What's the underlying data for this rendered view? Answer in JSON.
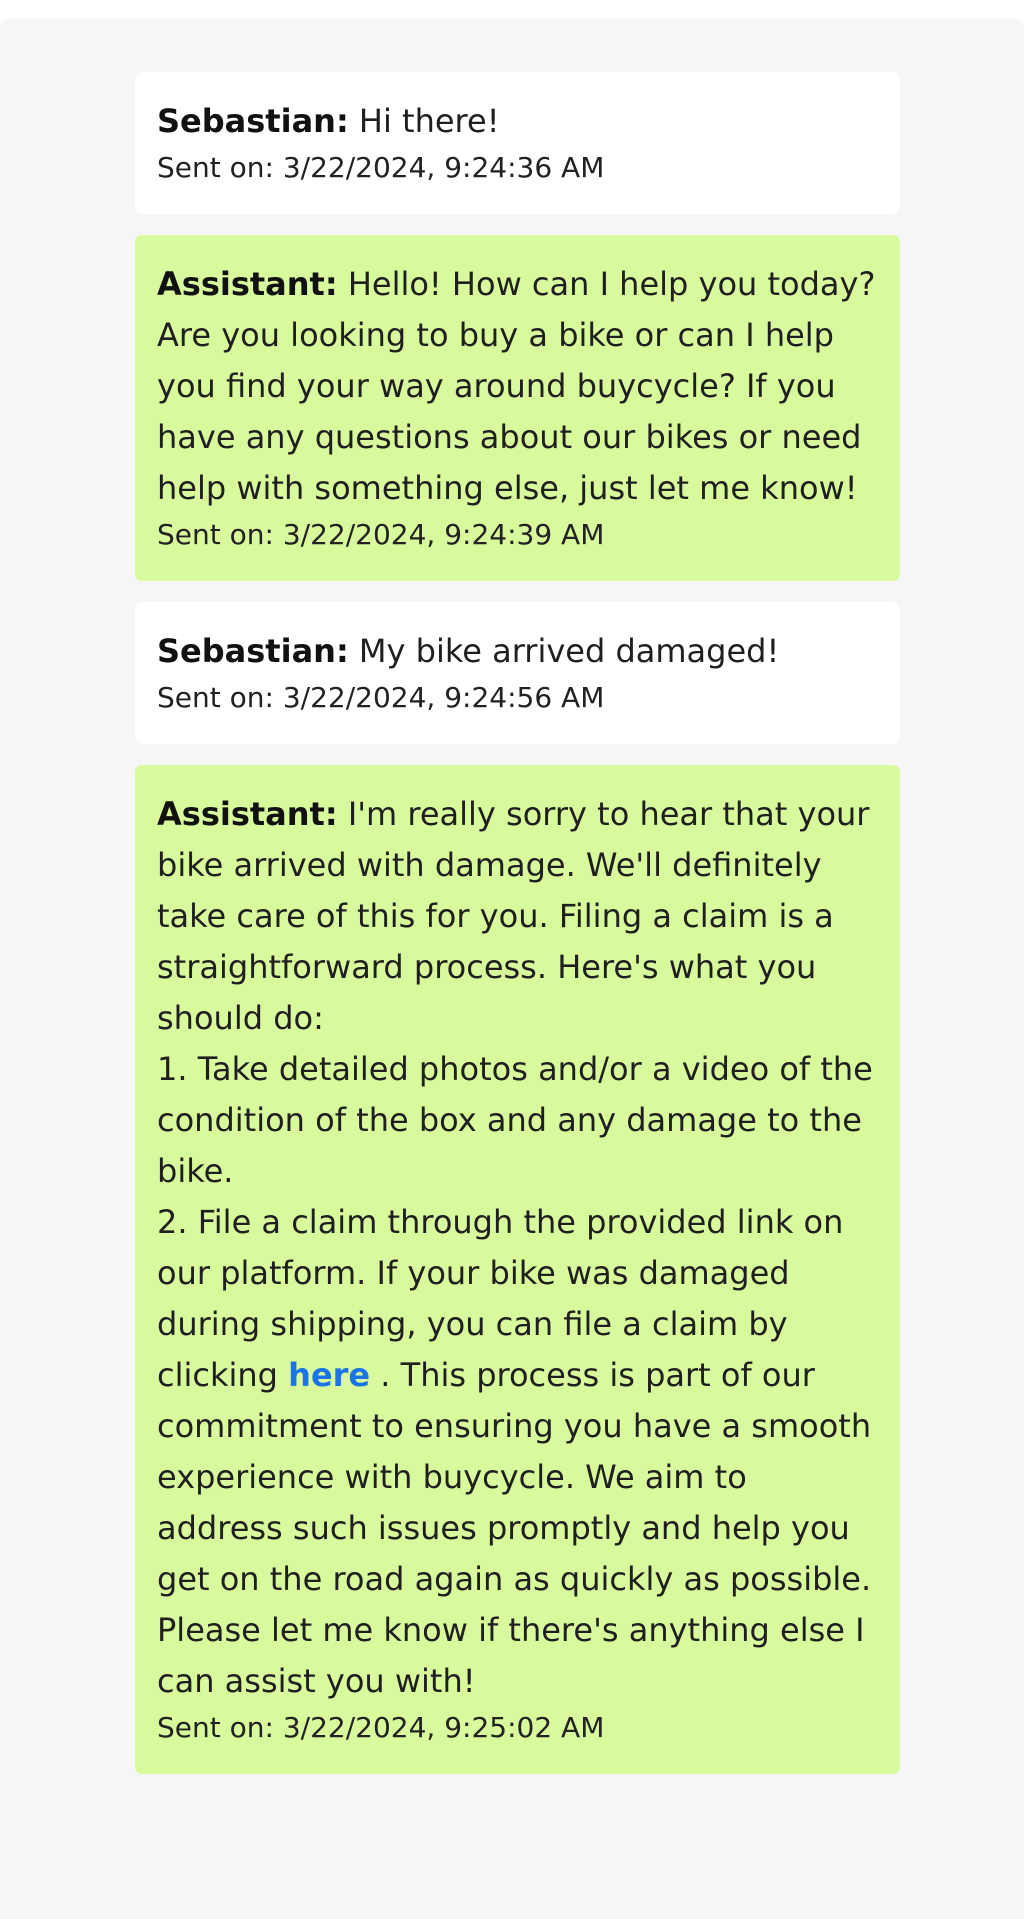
{
  "messages": [
    {
      "sender": "Sebastian:",
      "text": "Hi there!",
      "timestamp": "Sent on: 3/22/2024, 9:24:36 AM"
    },
    {
      "sender": "Assistant:",
      "text": "Hello! How can I help you today? Are you looking to buy a bike or can I help you find your way around buycycle? If you have any questions about our bikes or need help with something else, just let me know!",
      "timestamp": "Sent on: 3/22/2024, 9:24:39 AM"
    },
    {
      "sender": "Sebastian:",
      "text": "My bike arrived damaged!",
      "timestamp": "Sent on: 3/22/2024, 9:24:56 AM"
    },
    {
      "sender": "Assistant:",
      "intro": "I'm really sorry to hear that your bike arrived with damage. We'll definitely take care of this for you. Filing a claim is a straightforward process. Here's what you should do:",
      "step1": "1. Take detailed photos and/or a video of the condition of the box and any damage to the bike.",
      "step2_before": "2. File a claim through the provided link on our platform. If your bike was damaged during shipping, you can file a claim by clicking ",
      "link_text": "here",
      "step2_after": " . This process is part of our commitment to ensuring you have a smooth experience with buycycle. We aim to address such issues promptly and help you get on the road again as quickly as possible. Please let me know if there's anything else I can assist you with!",
      "timestamp": "Sent on: 3/22/2024, 9:25:02 AM"
    }
  ]
}
